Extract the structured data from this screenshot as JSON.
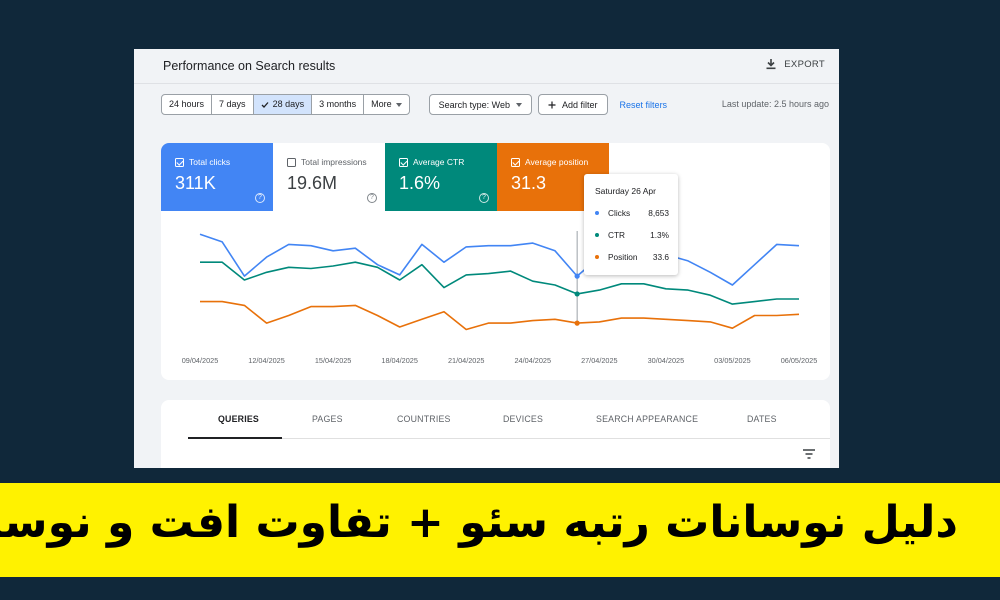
{
  "header": {
    "title": "Performance on Search results",
    "export_label": "EXPORT"
  },
  "filters": {
    "date_ranges": [
      {
        "label": "24 hours",
        "active": false
      },
      {
        "label": "7 days",
        "active": false
      },
      {
        "label": "28 days",
        "active": true
      },
      {
        "label": "3 months",
        "active": false
      },
      {
        "label": "More",
        "active": false
      }
    ],
    "search_type": "Search type: Web",
    "add_filter": "Add filter",
    "reset": "Reset filters",
    "last_update": "Last update: 2.5 hours ago"
  },
  "metrics": {
    "clicks": {
      "label": "Total clicks",
      "value": "311K",
      "checked": true,
      "color": "#4285f4"
    },
    "impressions": {
      "label": "Total impressions",
      "value": "19.6M",
      "checked": false,
      "color": "#ffffff"
    },
    "ctr": {
      "label": "Average CTR",
      "value": "1.6%",
      "checked": true,
      "color": "#00897b"
    },
    "position": {
      "label": "Average position",
      "value": "31.3",
      "checked": true,
      "color": "#e8710a"
    }
  },
  "tooltip": {
    "date": "Saturday 26 Apr",
    "rows": [
      {
        "label": "Clicks",
        "value": "8,653",
        "color": "#4285f4"
      },
      {
        "label": "CTR",
        "value": "1.3%",
        "color": "#00897b"
      },
      {
        "label": "Position",
        "value": "33.6",
        "color": "#e8710a"
      }
    ]
  },
  "chart_data": {
    "type": "line",
    "x": [
      "09/04/2025",
      "10/04/2025",
      "11/04/2025",
      "12/04/2025",
      "13/04/2025",
      "14/04/2025",
      "15/04/2025",
      "16/04/2025",
      "17/04/2025",
      "18/04/2025",
      "19/04/2025",
      "20/04/2025",
      "21/04/2025",
      "22/04/2025",
      "23/04/2025",
      "24/04/2025",
      "25/04/2025",
      "26/04/2025",
      "27/04/2025",
      "28/04/2025",
      "29/04/2025",
      "30/04/2025",
      "01/05/2025",
      "02/05/2025",
      "03/05/2025",
      "04/05/2025",
      "05/05/2025",
      "06/05/2025"
    ],
    "tick_labels": [
      "09/04/2025",
      "12/04/2025",
      "15/04/2025",
      "18/04/2025",
      "21/04/2025",
      "24/04/2025",
      "27/04/2025",
      "30/04/2025",
      "03/05/2025",
      "06/05/2025"
    ],
    "series": [
      {
        "name": "Clicks",
        "color": "#4285f4",
        "values": [
          0.88,
          0.82,
          0.55,
          0.7,
          0.8,
          0.79,
          0.75,
          0.77,
          0.64,
          0.56,
          0.8,
          0.66,
          0.78,
          0.79,
          0.79,
          0.81,
          0.75,
          0.55,
          0.7,
          0.71,
          0.69,
          0.72,
          0.67,
          0.58,
          0.48,
          0.64,
          0.8,
          0.79
        ]
      },
      {
        "name": "CTR",
        "color": "#00897b",
        "values": [
          0.66,
          0.66,
          0.52,
          0.58,
          0.62,
          0.61,
          0.63,
          0.66,
          0.62,
          0.52,
          0.64,
          0.46,
          0.56,
          0.57,
          0.59,
          0.51,
          0.48,
          0.41,
          0.44,
          0.49,
          0.49,
          0.45,
          0.44,
          0.4,
          0.33,
          0.35,
          0.37,
          0.37
        ]
      },
      {
        "name": "Position",
        "color": "#e8710a",
        "values": [
          0.35,
          0.35,
          0.32,
          0.18,
          0.24,
          0.31,
          0.31,
          0.32,
          0.24,
          0.15,
          0.21,
          0.27,
          0.13,
          0.18,
          0.18,
          0.2,
          0.21,
          0.18,
          0.19,
          0.22,
          0.22,
          0.21,
          0.2,
          0.19,
          0.14,
          0.24,
          0.24,
          0.25
        ]
      }
    ],
    "highlight_x": "26/04/2025",
    "grid": false
  },
  "tabs": [
    "QUERIES",
    "PAGES",
    "COUNTRIES",
    "DEVICES",
    "SEARCH APPEARANCE",
    "DATES"
  ],
  "banner": {
    "text": "دلیل نوسانات رتبه سئو + تفاوت افت و نوسان"
  }
}
